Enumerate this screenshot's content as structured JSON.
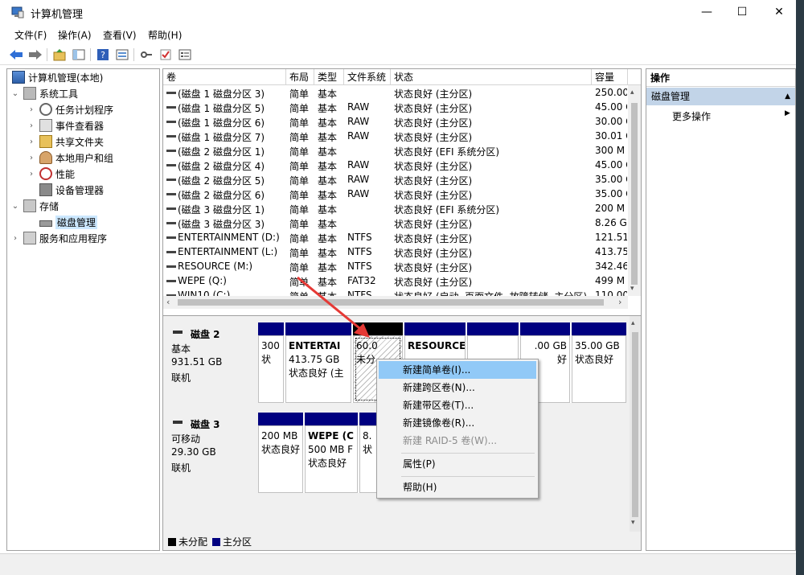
{
  "window": {
    "title": "计算机管理",
    "controls": {
      "minimize": "—",
      "maximize": "☐",
      "close": "✕"
    }
  },
  "menu": [
    "文件(F)",
    "操作(A)",
    "查看(V)",
    "帮助(H)"
  ],
  "tree": {
    "root": "计算机管理(本地)",
    "system_tools": "系统工具",
    "task_scheduler": "任务计划程序",
    "event_viewer": "事件查看器",
    "shared_folders": "共享文件夹",
    "local_users": "本地用户和组",
    "performance": "性能",
    "device_manager": "设备管理器",
    "storage": "存储",
    "disk_management": "磁盘管理",
    "services": "服务和应用程序"
  },
  "volume_table": {
    "columns": [
      "卷",
      "布局",
      "类型",
      "文件系统",
      "状态",
      "容量"
    ],
    "rows": [
      [
        "(磁盘 1 磁盘分区 3)",
        "简单",
        "基本",
        "",
        "状态良好 (主分区)",
        "250.00"
      ],
      [
        "(磁盘 1 磁盘分区 5)",
        "简单",
        "基本",
        "RAW",
        "状态良好 (主分区)",
        "45.00 G"
      ],
      [
        "(磁盘 1 磁盘分区 6)",
        "简单",
        "基本",
        "RAW",
        "状态良好 (主分区)",
        "30.00 G"
      ],
      [
        "(磁盘 1 磁盘分区 7)",
        "简单",
        "基本",
        "RAW",
        "状态良好 (主分区)",
        "30.01 G"
      ],
      [
        "(磁盘 2 磁盘分区 1)",
        "简单",
        "基本",
        "",
        "状态良好 (EFI 系统分区)",
        "300 M"
      ],
      [
        "(磁盘 2 磁盘分区 4)",
        "简单",
        "基本",
        "RAW",
        "状态良好 (主分区)",
        "45.00 G"
      ],
      [
        "(磁盘 2 磁盘分区 5)",
        "简单",
        "基本",
        "RAW",
        "状态良好 (主分区)",
        "35.00 G"
      ],
      [
        "(磁盘 2 磁盘分区 6)",
        "简单",
        "基本",
        "RAW",
        "状态良好 (主分区)",
        "35.00 G"
      ],
      [
        "(磁盘 3 磁盘分区 1)",
        "简单",
        "基本",
        "",
        "状态良好 (EFI 系统分区)",
        "200 M"
      ],
      [
        "(磁盘 3 磁盘分区 3)",
        "简单",
        "基本",
        "",
        "状态良好 (主分区)",
        "8.26 G"
      ],
      [
        "ENTERTAINMENT (D:)",
        "简单",
        "基本",
        "NTFS",
        "状态良好 (主分区)",
        "121.51"
      ],
      [
        "ENTERTAINMENT (L:)",
        "简单",
        "基本",
        "NTFS",
        "状态良好 (主分区)",
        "413.75"
      ],
      [
        "RESOURCE (M:)",
        "简单",
        "基本",
        "NTFS",
        "状态良好 (主分区)",
        "342.46"
      ],
      [
        "WEPE (Q:)",
        "简单",
        "基本",
        "FAT32",
        "状态良好 (主分区)",
        "499 M"
      ],
      [
        "WIN10 (C:)",
        "简单",
        "基本",
        "NTFS",
        "状态良好 (启动, 页面文件, 故障转储, 主分区)",
        "110.00"
      ]
    ]
  },
  "disks": [
    {
      "name": "磁盘 2",
      "type": "基本",
      "size": "931.51 GB",
      "status": "联机",
      "parts": [
        {
          "l1": "300",
          "l2": "状"
        },
        {
          "l1": "ENTERTAI",
          "l2": "413.75 GB",
          "l3": "状态良好 (主"
        },
        {
          "l1": "60.0",
          "l2": "未分"
        },
        {
          "l1": "RESOURCE",
          "l2": "",
          "l3": ""
        },
        {
          "l1": "",
          "l2": ""
        },
        {
          "l1": ".00 GB",
          "l2": "好"
        },
        {
          "l1": "35.00 GB",
          "l2": "状态良好"
        }
      ]
    },
    {
      "name": "磁盘 3",
      "type": "可移动",
      "size": "29.30 GB",
      "status": "联机",
      "parts": [
        {
          "l1": "200 MB",
          "l2": "状态良好"
        },
        {
          "l1": "WEPE (C",
          "l2": "500 MB F",
          "l3": "状态良好"
        },
        {
          "l1": "8.",
          "l2": "状"
        }
      ]
    }
  ],
  "legend": {
    "unallocated": "未分配",
    "primary": "主分区"
  },
  "actions": {
    "header": "操作",
    "section": "磁盘管理",
    "more": "更多操作"
  },
  "context_menu": {
    "new_simple": "新建简单卷(I)...",
    "new_spanned": "新建跨区卷(N)...",
    "new_striped": "新建带区卷(T)...",
    "new_mirrored": "新建镜像卷(R)...",
    "new_raid5": "新建 RAID-5 卷(W)...",
    "properties": "属性(P)",
    "help": "帮助(H)"
  },
  "colors": {
    "primary": "#000080",
    "unallocated": "#000000",
    "highlight": "#91c9f7",
    "arrow": "#e53935"
  }
}
